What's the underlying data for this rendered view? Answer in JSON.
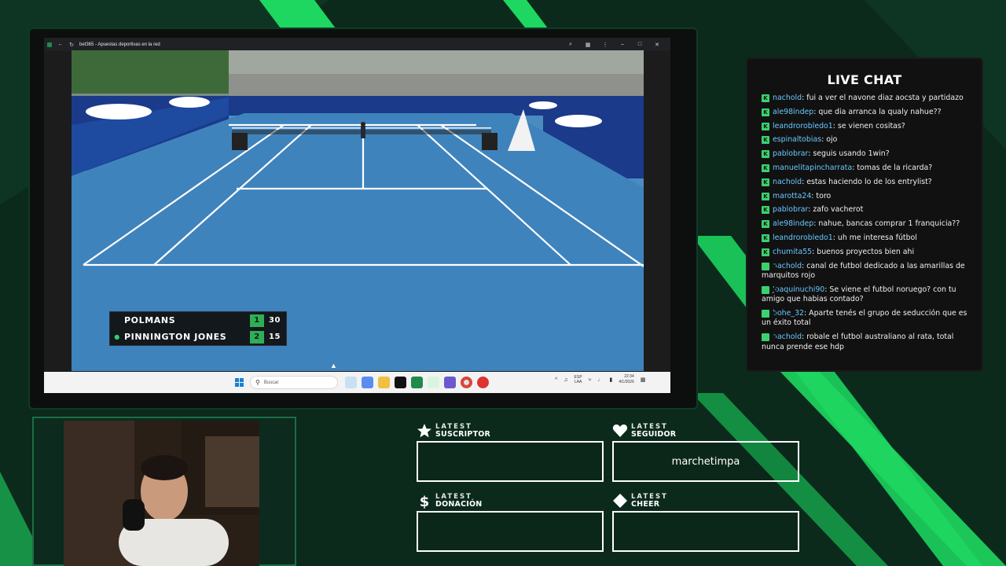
{
  "browser": {
    "tab_title": "bet365 - Apuestas deportivas en la red",
    "back_icon": "back-arrow-icon",
    "reload_icon": "reload-icon"
  },
  "scoreboard": {
    "players": [
      {
        "name": "POLMANS",
        "sets": "1",
        "points": "30",
        "serving": false
      },
      {
        "name": "PINNINGTON JONES",
        "sets": "2",
        "points": "15",
        "serving": true
      }
    ],
    "accent": "#2fae57"
  },
  "taskbar": {
    "search_placeholder": "Buscar",
    "lang_line1": "ESP",
    "lang_line2": "LAA",
    "time": "22:34",
    "date": "4/1/2026"
  },
  "chat": {
    "title": "LIVE CHAT",
    "username_color": "#69c8ff",
    "badge_color": "#3bd16f",
    "messages": [
      {
        "user": "nachold",
        "text": ": fui a ver el navone diaz aocsta y partidazo"
      },
      {
        "user": "ale98indep",
        "text": ": que dia arranca la qualy nahue??"
      },
      {
        "user": "leandrorobledo1",
        "text": ": se vienen cositas?"
      },
      {
        "user": "espinaltobias",
        "text": ": ojo"
      },
      {
        "user": "pablobrar",
        "text": ": seguis usando 1win?"
      },
      {
        "user": "manuelitapincharrata",
        "text": ": tomas de la ricarda?"
      },
      {
        "user": "nachold",
        "text": ": estas haciendo lo de los entrylist?"
      },
      {
        "user": "marotta24",
        "text": ": toro"
      },
      {
        "user": "pablobrar",
        "text": ": zafo vacherot"
      },
      {
        "user": "ale98indep",
        "text": ": nahue, bancas comprar 1 franquicia??"
      },
      {
        "user": "leandrorobledo1",
        "text": ": uh me interesa fútbol"
      },
      {
        "user": "chumita55",
        "text": ": buenos proyectos bien ahi"
      },
      {
        "user": "nachold",
        "text": ": canal de futbol dedicado a las amarillas de marquitos rojo"
      },
      {
        "user": "Joaquinuchi90",
        "text": ": Se viene el futbol noruego? con tu amigo que habias contado?"
      },
      {
        "user": "bohe_32",
        "text": ": Aparte tenés el grupo de seducción que es un éxito total"
      },
      {
        "user": "nachold",
        "text": ": robale el futbol australiano al rata, total nunca prende ese hdp"
      }
    ]
  },
  "latest": {
    "suscriptor": {
      "label_top": "LATEST",
      "label_bottom": "SUSCRIPTOR",
      "value": "",
      "icon": "star-icon"
    },
    "seguidor": {
      "label_top": "LATEST",
      "label_bottom": "SEGUIDOR",
      "value": "marchetimpa",
      "icon": "heart-icon"
    },
    "donacion": {
      "label_top": "LATEST",
      "label_bottom": "DONACIÓN",
      "value": "",
      "icon": "dollar-icon"
    },
    "cheer": {
      "label_top": "LATEST",
      "label_bottom": "CHEER",
      "value": "",
      "icon": "diamond-icon"
    }
  }
}
